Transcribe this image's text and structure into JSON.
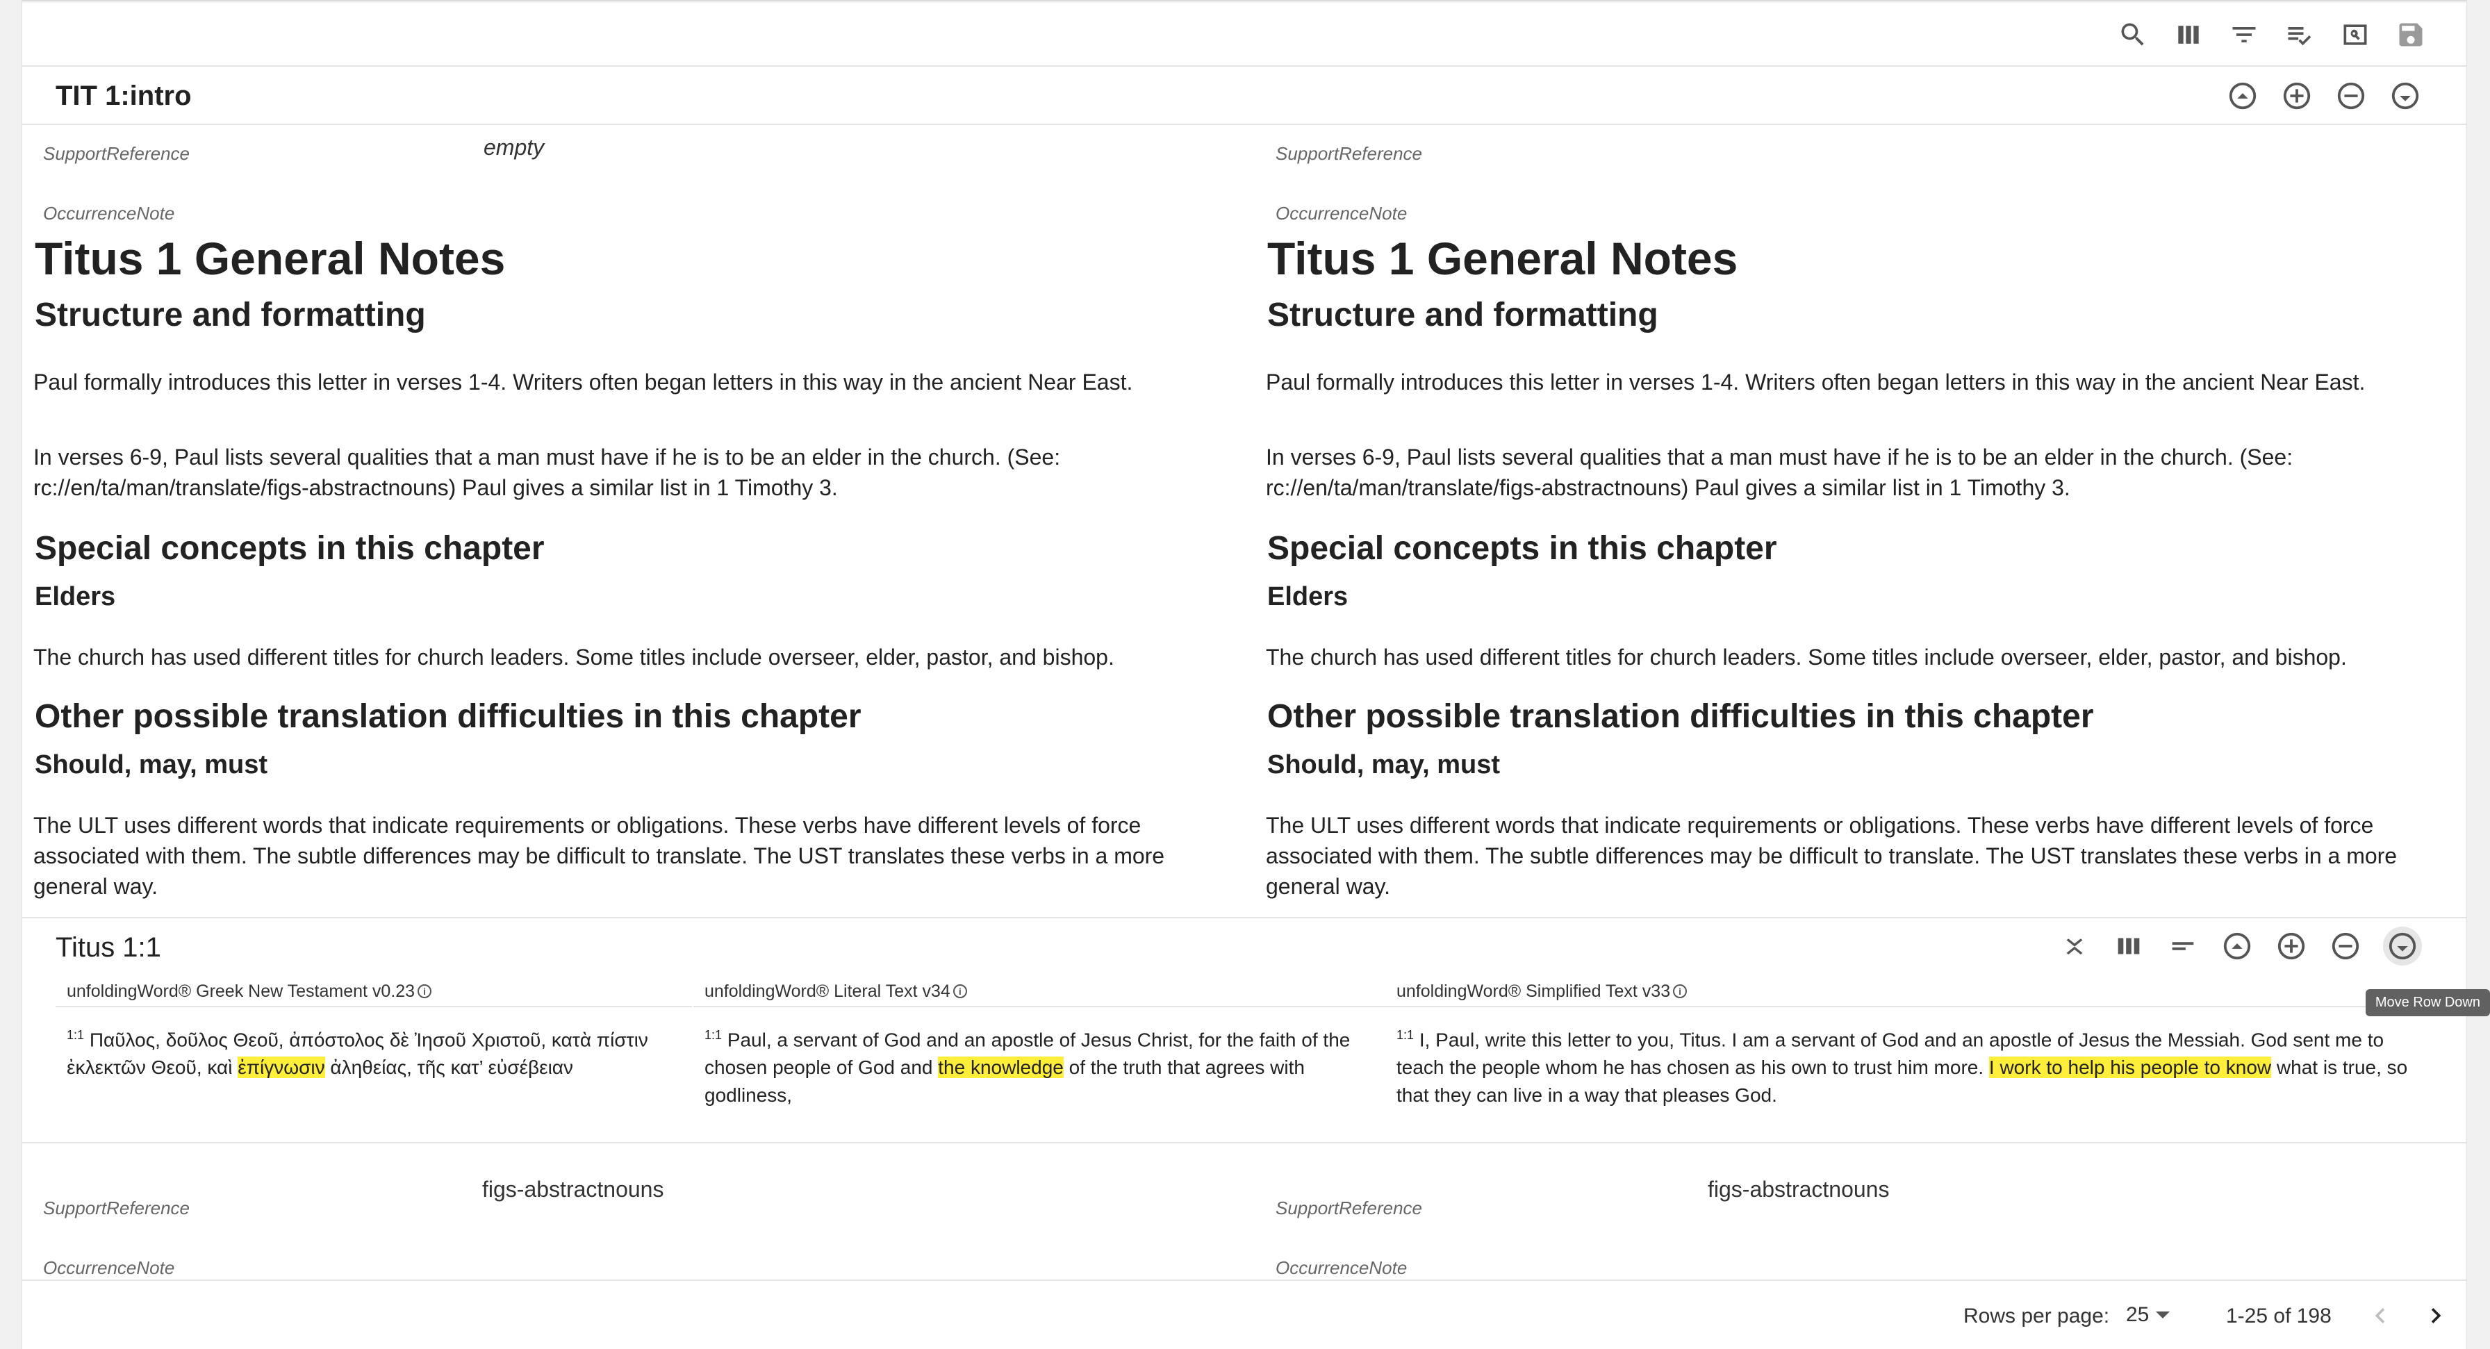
{
  "toolbar": {
    "icons": [
      "search-icon",
      "view-columns-icon",
      "filter-icon",
      "checklist-icon",
      "preview-icon",
      "save-icon"
    ]
  },
  "intro_row": {
    "title": "TIT 1:intro",
    "controls": [
      "move-row-up-icon",
      "expand-row-icon",
      "collapse-row-icon",
      "move-row-down-icon"
    ],
    "left": {
      "support_label": "SupportReference",
      "support_value": "empty",
      "occurrence_label": "OccurrenceNote",
      "h1": "Titus 1 General Notes",
      "h2_structure": "Structure and formatting",
      "p1": "Paul formally introduces this letter in verses 1-4. Writers often began letters in this way in the ancient Near East.",
      "p2": "In verses 6-9, Paul lists several qualities that a man must have if he is to be an elder in the church. (See: rc://en/ta/man/translate/figs-abstractnouns) Paul gives a similar list in 1 Timothy 3.",
      "h2_special": "Special concepts in this chapter",
      "h3_elders": "Elders",
      "p3": "The church has used different titles for church leaders. Some titles include overseer, elder, pastor, and bishop.",
      "h2_other": "Other possible translation difficulties in this chapter",
      "h3_should": "Should, may, must",
      "p4": "The ULT uses different words that indicate requirements or obligations. These verbs have different levels of force associated with them. The subtle differences may be difficult to translate. The UST translates these verbs in a more general way."
    },
    "right": {
      "support_label": "SupportReference",
      "occurrence_label": "OccurrenceNote",
      "h1": "Titus 1 General Notes",
      "h2_structure": "Structure and formatting",
      "p1": "Paul formally introduces this letter in verses 1-4. Writers often began letters in this way in the ancient Near East.",
      "p2": "In verses 6-9, Paul lists several qualities that a man must have if he is to be an elder in the church. (See: rc://en/ta/man/translate/figs-abstractnouns) Paul gives a similar list in 1 Timothy 3.",
      "h2_special": "Special concepts in this chapter",
      "h3_elders": "Elders",
      "p3": "The church has used different titles for church leaders. Some titles include overseer, elder, pastor, and bishop.",
      "h2_other": "Other possible translation difficulties in this chapter",
      "h3_should": "Should, may, must",
      "p4": "The ULT uses different words that indicate requirements or obligations. These verbs have different levels of force associated with them. The subtle differences may be difficult to translate. The UST translates these verbs in a more general way."
    }
  },
  "verse_row": {
    "title": "Titus 1:1",
    "controls": [
      "expand-collapse-icon",
      "view-columns-icon",
      "short-text-icon",
      "move-row-up-icon",
      "expand-row-icon",
      "collapse-row-icon",
      "move-row-down-icon"
    ],
    "tooltip": "Move Row Down",
    "columns": [
      {
        "title": "unfoldingWord® Greek New Testament v0.23",
        "verse_num": "1:1",
        "before": "Παῦλος, δοῦλος Θεοῦ, ἀπόστολος δὲ Ἰησοῦ Χριστοῦ, κατὰ πίστιν ἐκλεκτῶν Θεοῦ, καὶ ",
        "highlight": "ἐπίγνωσιν",
        "after": " ἀληθείας, τῆς κατ’ εὐσέβειαν"
      },
      {
        "title": "unfoldingWord® Literal Text v34",
        "verse_num": "1:1",
        "before": "Paul, a servant of God and an apostle of Jesus Christ, for the faith of the chosen people of God and ",
        "highlight": "the knowledge",
        "after": " of the truth that agrees with godliness,"
      },
      {
        "title": "unfoldingWord® Simplified Text v33",
        "verse_num": "1:1",
        "before": "I, Paul, write this letter to you, Titus. I am a servant of God and an apostle of Jesus the Messiah. God sent me to teach the people whom he has chosen as his own to trust him more. ",
        "highlight": "I work to help his people to know",
        "after": " what is true, so that they can live in a way that pleases God."
      }
    ]
  },
  "bottom_row": {
    "left": {
      "support_label": "SupportReference",
      "support_value": "figs-abstractnouns",
      "occurrence_label": "OccurrenceNote"
    },
    "right": {
      "support_label": "SupportReference",
      "support_value": "figs-abstractnouns",
      "occurrence_label": "OccurrenceNote"
    }
  },
  "pagination": {
    "rows_per_page_label": "Rows per page:",
    "rows_per_page_value": "25",
    "range": "1-25 of 198"
  }
}
